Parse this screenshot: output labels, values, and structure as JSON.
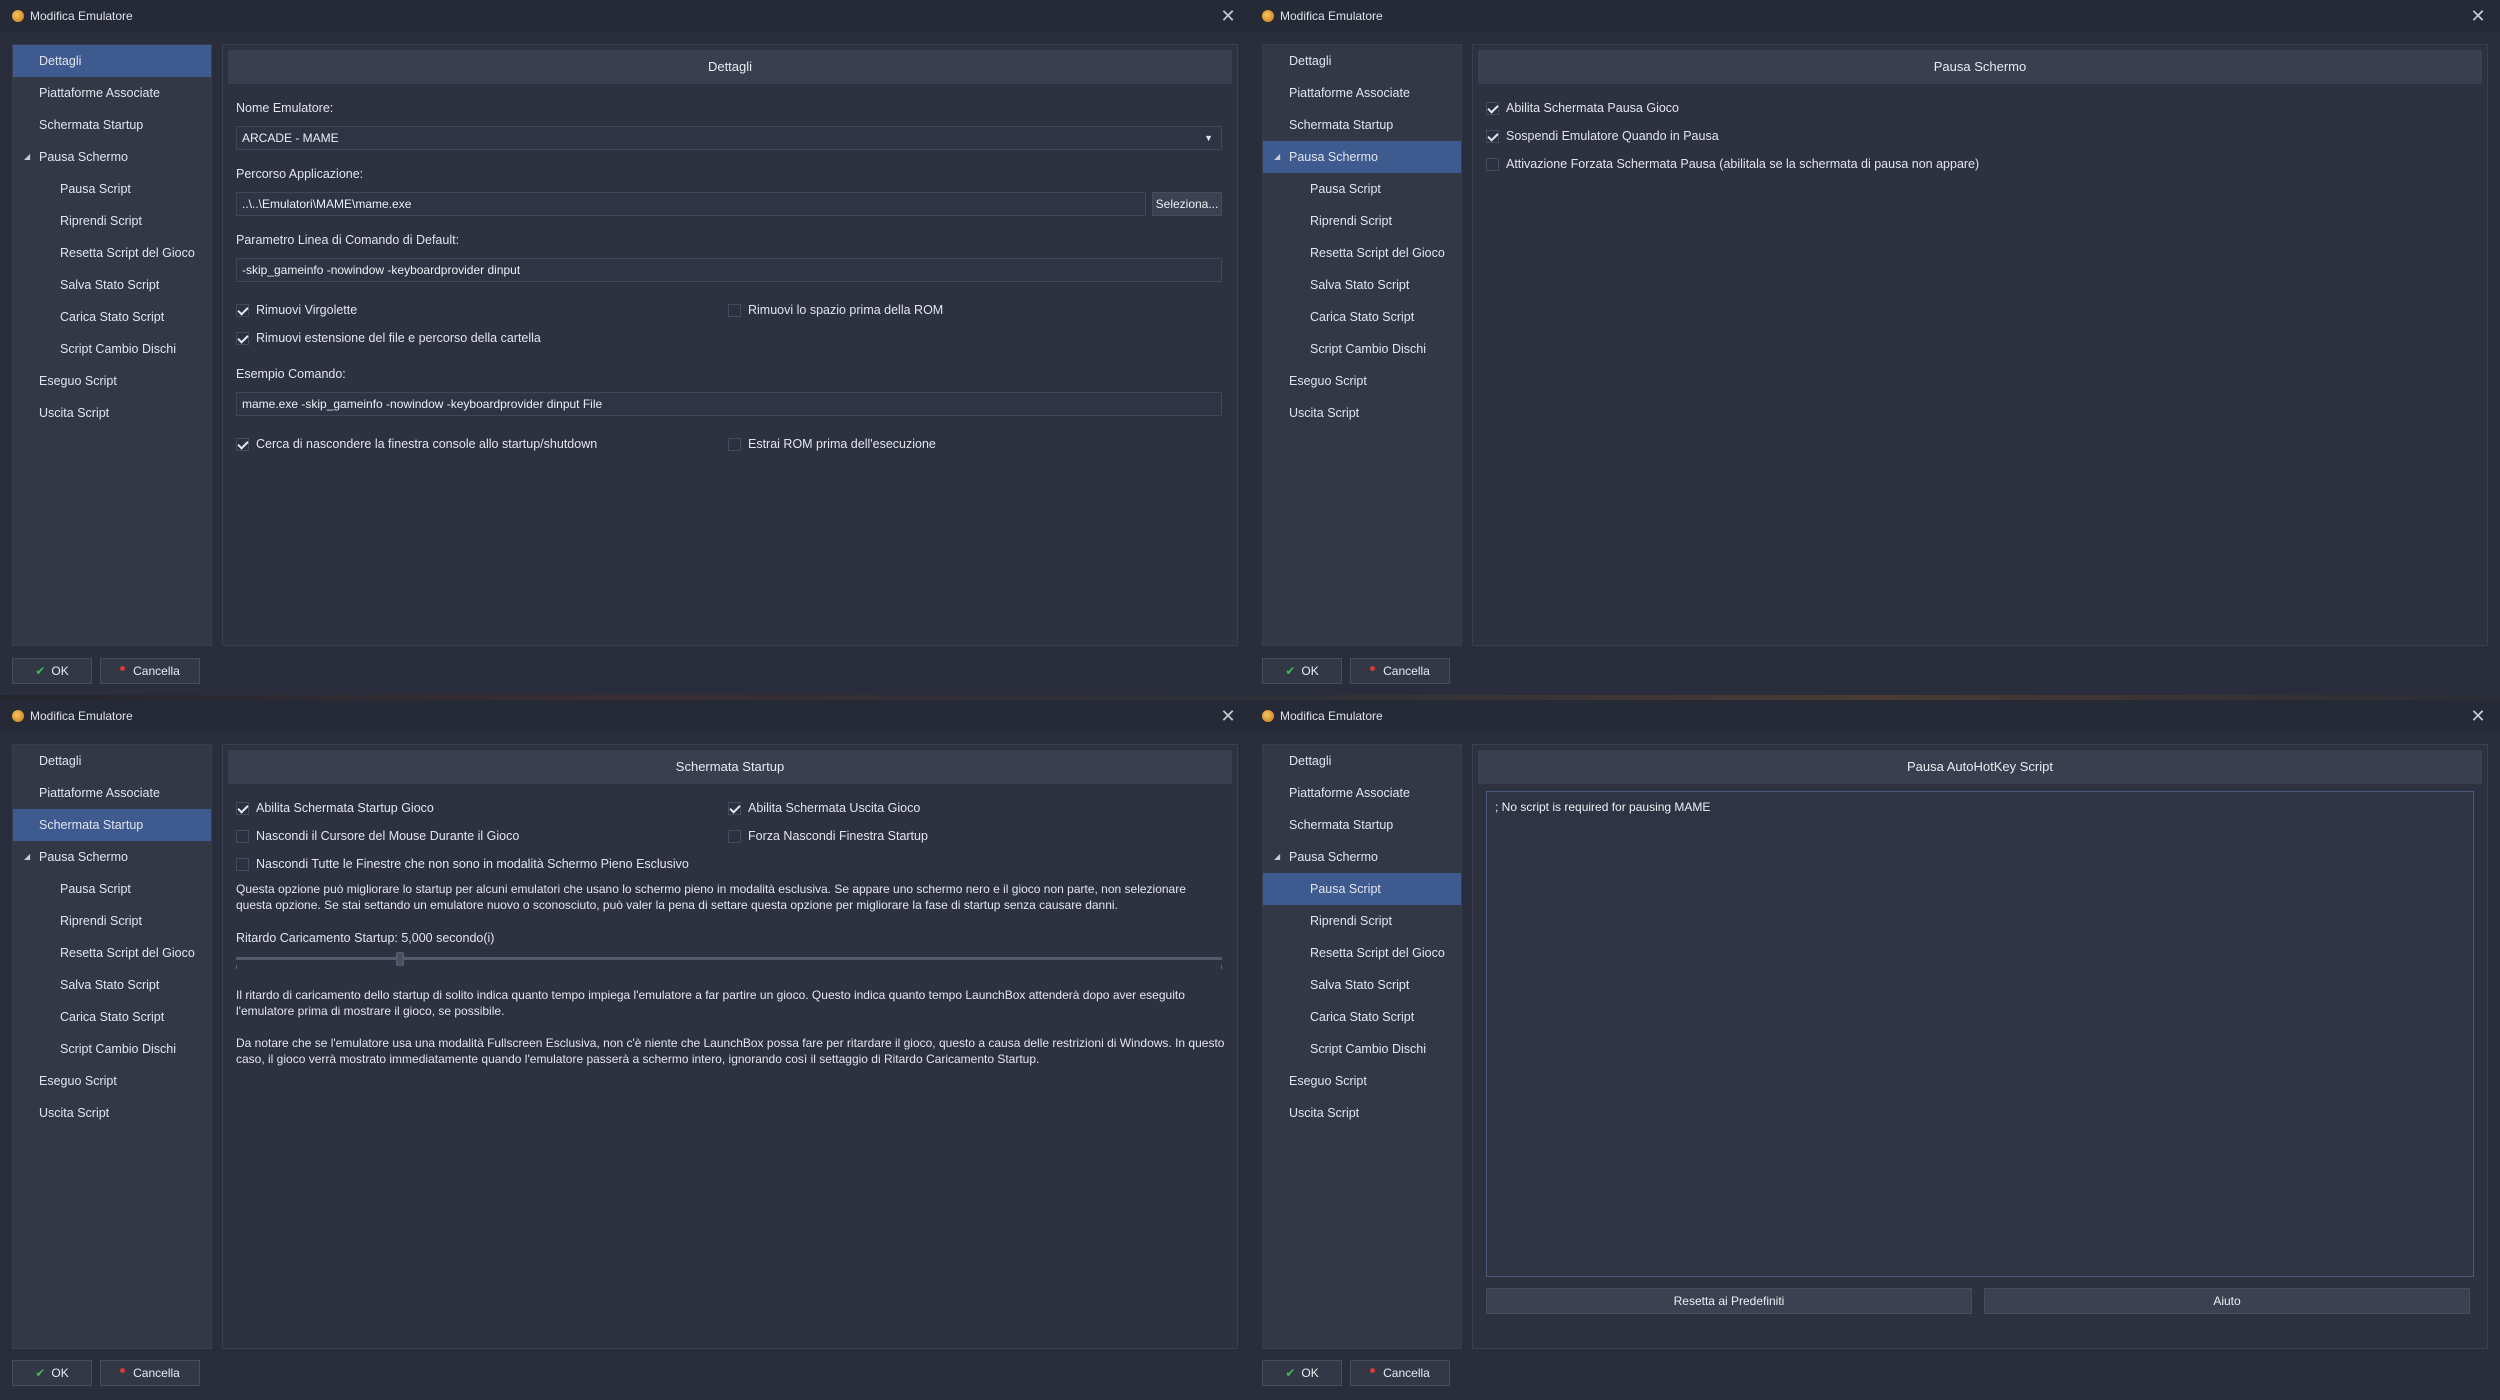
{
  "window_title": "Modifica Emulatore",
  "close_glyph": "✕",
  "nav": {
    "dettagli": "Dettagli",
    "piattaforme": "Piattaforme Associate",
    "startup": "Schermata Startup",
    "pausa": "Pausa Schermo",
    "pausa_script": "Pausa Script",
    "riprendi": "Riprendi Script",
    "resetta": "Resetta Script del Gioco",
    "salva": "Salva Stato Script",
    "carica": "Carica Stato Script",
    "cambio": "Script Cambio Dischi",
    "esegui": "Eseguo Script",
    "uscita": "Uscita Script",
    "expand_arrow": "◢"
  },
  "footer": {
    "ok": "OK",
    "cancel": "Cancella",
    "ok_icon": "check-icon"
  },
  "details": {
    "header": "Dettagli",
    "name_label": "Nome Emulatore:",
    "name_value": "ARCADE - MAME",
    "path_label": "Percorso Applicazione:",
    "path_value": "..\\..\\Emulatori\\MAME\\mame.exe",
    "browse": "Seleziona...",
    "params_label": "Parametro Linea di Comando di Default:",
    "params_value": "-skip_gameinfo -nowindow -keyboardprovider dinput",
    "remove_quotes": "Rimuovi Virgolette",
    "remove_space": "Rimuovi lo spazio prima della ROM",
    "remove_ext": "Rimuovi estensione del file e percorso della cartella",
    "example_label": "Esempio Comando:",
    "example_value": "mame.exe -skip_gameinfo -nowindow -keyboardprovider dinput File",
    "hide_console": "Cerca di nascondere la finestra console allo startup/shutdown",
    "extract_rom": "Estrai ROM prima dell'esecuzione"
  },
  "pause": {
    "header": "Pausa Schermo",
    "enable": "Abilita Schermata Pausa Gioco",
    "suspend": "Sospendi Emulatore Quando in Pausa",
    "force": "Attivazione Forzata Schermata Pausa (abilitala se la schermata di pausa non appare)"
  },
  "startup": {
    "header": "Schermata Startup",
    "enable_startup": "Abilita Schermata Startup Gioco",
    "enable_exit": "Abilita Schermata Uscita Gioco",
    "hide_cursor": "Nascondi il Cursore del Mouse Durante il Gioco",
    "force_hide": "Forza Nascondi Finestra Startup",
    "hide_windows": "Nascondi Tutte le Finestre che non sono in modalità Schermo Pieno Esclusivo",
    "info1_line1": "Questa opzione può migliorare lo startup per alcuni emulatori che usano lo schermo pieno in modalità esclusiva. Se appare uno schermo nero e il gioco non parte, non selezionare",
    "info1_line2": "questa opzione. Se stai settando un emulatore nuovo o sconosciuto, può valer la pena di settare questa opzione per migliorare la fase di startup senza causare danni.",
    "delay_label": "Ritardo Caricamento Startup: 5,000 secondo(i)",
    "delay_seconds": 5,
    "info2_line1": "Il ritardo di caricamento dello startup di solito indica quanto tempo impiega l'emulatore a far partire un gioco. Questo indica quanto tempo LaunchBox attenderà dopo aver eseguito",
    "info2_line2": "l'emulatore prima di mostrare il gioco, se possibile.",
    "info3_line1": "Da notare che se l'emulatore usa una modalità Fullscreen Esclusiva, non c'è niente che LaunchBox possa fare per ritardare il gioco, questo a causa delle restrizioni di Windows. In questo",
    "info3_line2": "caso, il gioco verrà mostrato immediatamente quando l'emulatore passerà a schermo intero, ignorando così il settaggio di Ritardo Caricamento Startup."
  },
  "ahk": {
    "header": "Pausa AutoHotKey Script",
    "script": "; No script is required for pausing MAME",
    "reset": "Resetta ai Predefiniti",
    "help": "Aiuto"
  },
  "colors": {
    "accent": "#3e5a8f",
    "ok_green": "#3dbb55",
    "cancel_red": "#d23a3a"
  }
}
